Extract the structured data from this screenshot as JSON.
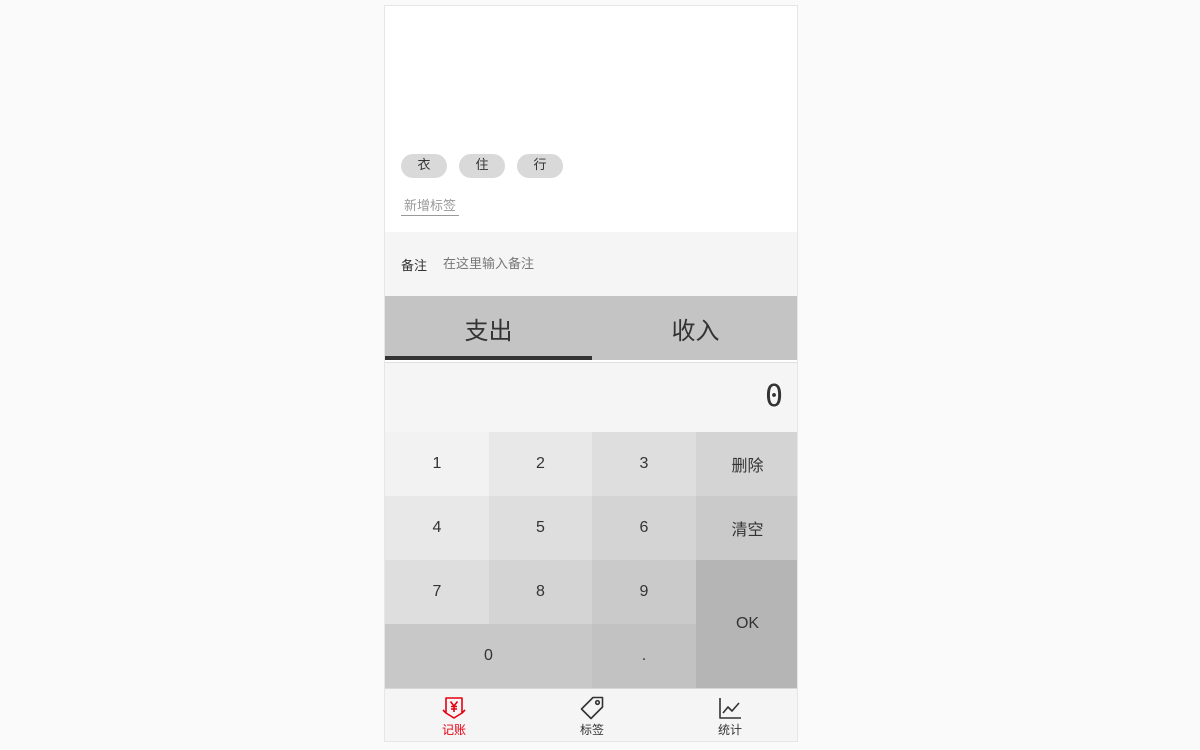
{
  "tags": {
    "items": [
      "衣",
      "住",
      "行"
    ],
    "new_tag_label": "新增标签"
  },
  "notes": {
    "label": "备注",
    "placeholder": "在这里输入备注",
    "value": ""
  },
  "type_tabs": [
    {
      "label": "支出",
      "selected": true
    },
    {
      "label": "收入",
      "selected": false
    }
  ],
  "output": {
    "value": "0"
  },
  "keypad": {
    "k1": "1",
    "k2": "2",
    "k3": "3",
    "delete": "删除",
    "k4": "4",
    "k5": "5",
    "k6": "6",
    "clear": "清空",
    "k7": "7",
    "k8": "8",
    "k9": "9",
    "ok": "OK",
    "k0": "0",
    "dot": "."
  },
  "nav": {
    "items": [
      {
        "label": "记账",
        "icon": "yen-icon",
        "active": true
      },
      {
        "label": "标签",
        "icon": "tag-icon",
        "active": false
      },
      {
        "label": "统计",
        "icon": "chart-icon",
        "active": false
      }
    ],
    "active_color": "#e60012"
  }
}
